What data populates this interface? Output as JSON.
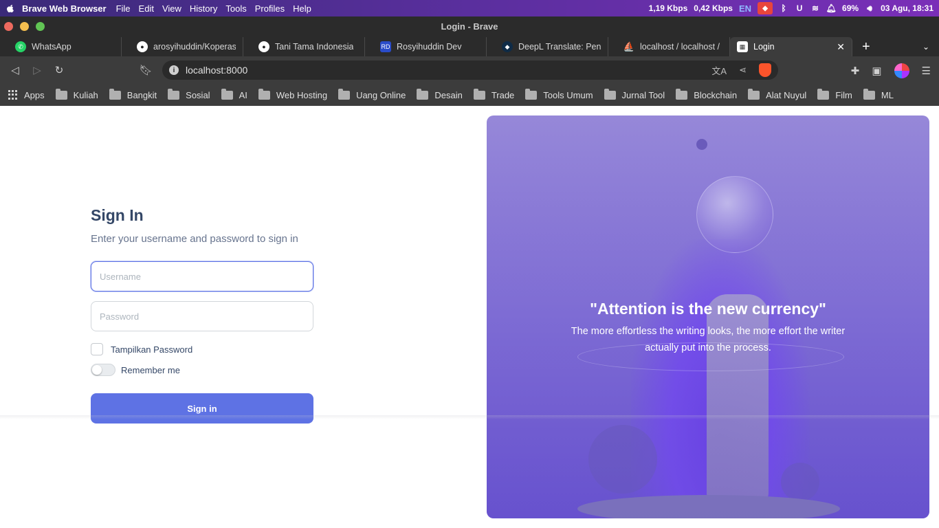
{
  "menubar": {
    "app_name": "Brave Web Browser",
    "menus": [
      "File",
      "Edit",
      "View",
      "History",
      "Tools",
      "Profiles",
      "Help"
    ],
    "net_down": "1,19 Kbps",
    "net_up": "0,42 Kbps",
    "lang": "EN",
    "battery": "69%",
    "datetime": "03 Agu, 18:31"
  },
  "window": {
    "title": "Login - Brave"
  },
  "tabs": [
    {
      "label": "WhatsApp",
      "icon": "whatsapp-icon",
      "color": "#25d366"
    },
    {
      "label": "arosyihuddin/Koperasi-Si",
      "icon": "github-icon",
      "color": "#ffffff"
    },
    {
      "label": "Tani Tama Indonesia",
      "icon": "github-icon",
      "color": "#ffffff"
    },
    {
      "label": "Rosyihuddin Dev",
      "icon": "dev-icon",
      "color": "#2a4cc9"
    },
    {
      "label": "DeepL Translate: Penerje",
      "icon": "deepl-icon",
      "color": "#0f2b46"
    },
    {
      "label": "localhost / localhost / kop",
      "icon": "phpmyadmin-icon",
      "color": "#f89c0e"
    },
    {
      "label": "Login",
      "icon": "page-icon",
      "color": "#ffffff",
      "active": true
    }
  ],
  "toolbar": {
    "url": "localhost:8000"
  },
  "bookmarks": [
    "Apps",
    "Kuliah",
    "Bangkit",
    "Sosial",
    "AI",
    "Web Hosting",
    "Uang Online",
    "Desain",
    "Trade",
    "Tools Umum",
    "Jurnal Tool",
    "Blockchain",
    "Alat Nuyul",
    "Film",
    "ML"
  ],
  "login": {
    "title": "Sign In",
    "subtitle": "Enter your username and password to sign in",
    "username_placeholder": "Username",
    "password_placeholder": "Password",
    "show_password_label": "Tampilkan Password",
    "remember_label": "Remember me",
    "submit_label": "Sign in"
  },
  "hero": {
    "quote": "\"Attention is the new currency\"",
    "text": "The more effortless the writing looks, the more effort the writer actually put into the process."
  }
}
